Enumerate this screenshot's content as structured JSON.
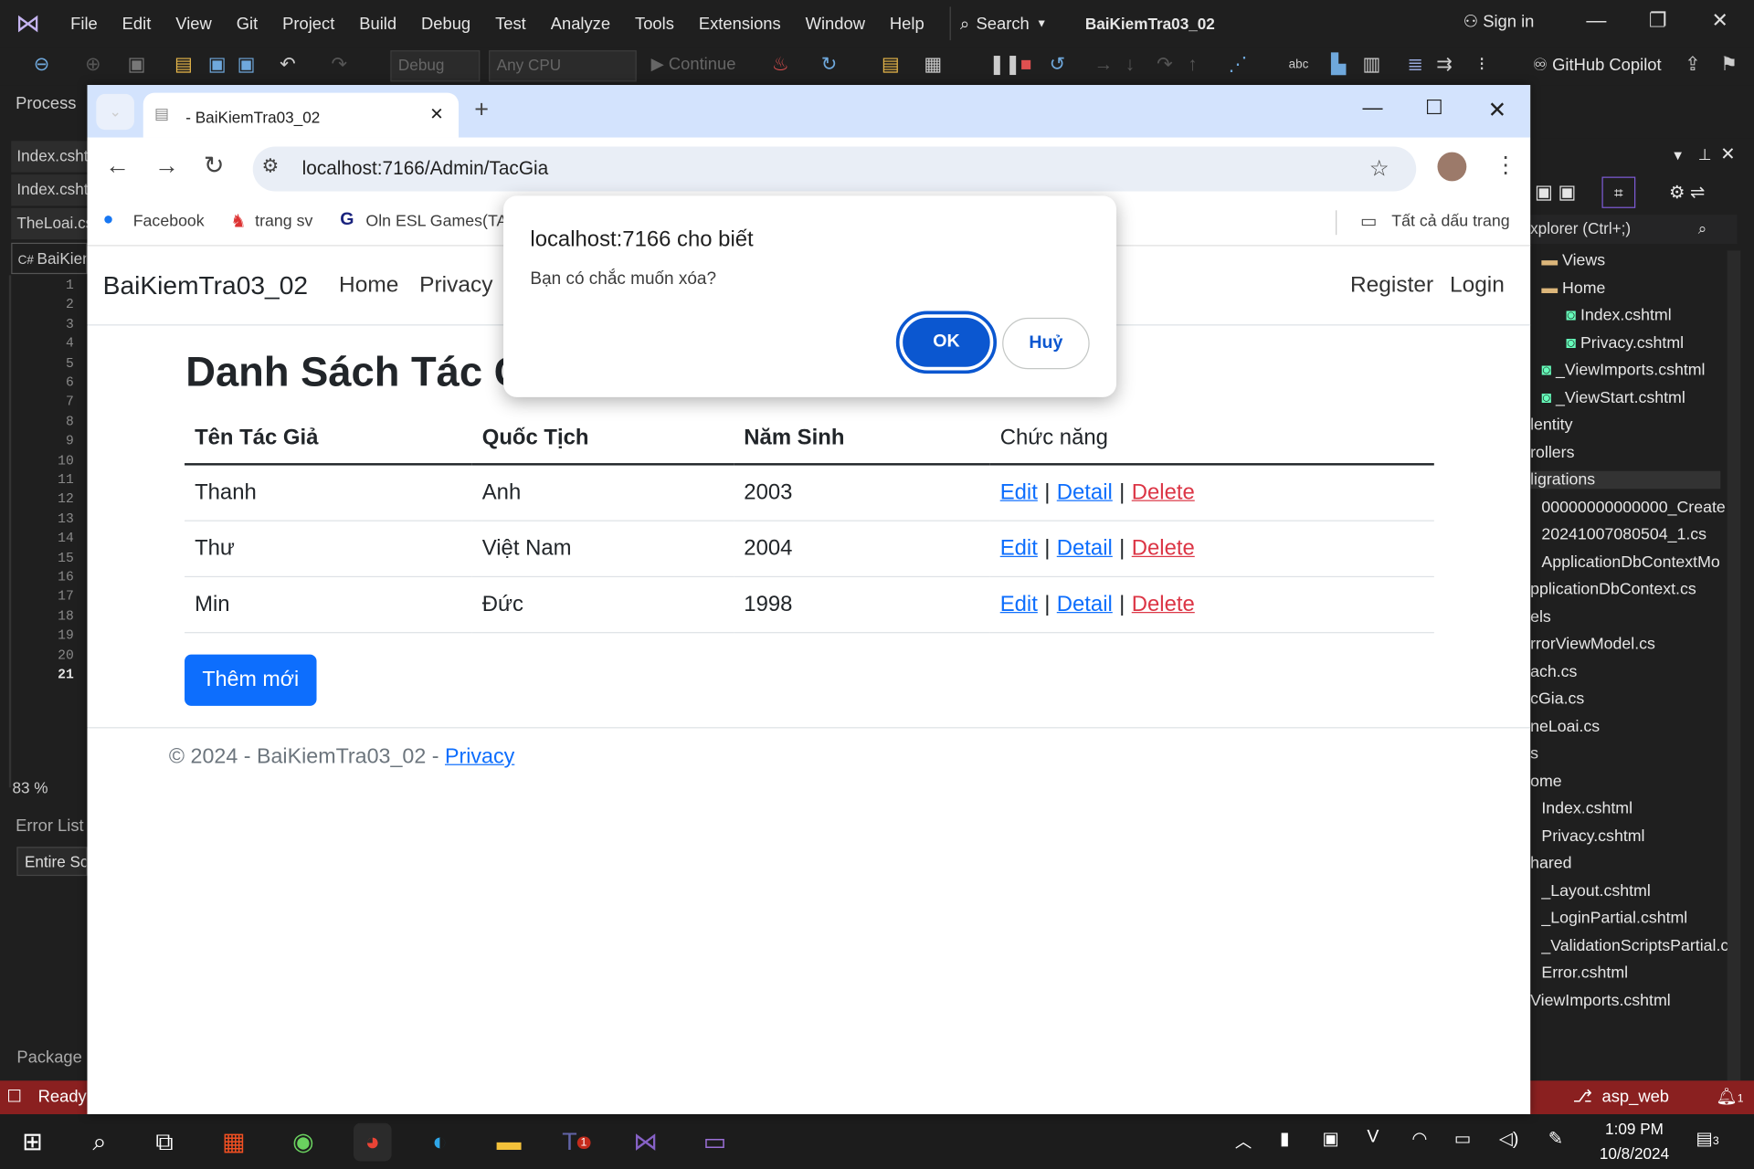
{
  "vs": {
    "menu": [
      "File",
      "Edit",
      "View",
      "Git",
      "Project",
      "Build",
      "Debug",
      "Test",
      "Analyze",
      "Tools",
      "Extensions",
      "Window",
      "Help"
    ],
    "search_label": "Search",
    "solution_title": "BaiKiemTra03_02",
    "sign_in": "Sign in",
    "config": "Debug",
    "platform": "Any CPU",
    "continue_label": "Continue",
    "copilot_label": "GitHub Copilot",
    "process_label": "Process",
    "left_tabs": [
      "Index.csht",
      "Index.csht",
      "TheLoai.cs",
      "BaiKien"
    ],
    "line_numbers": [
      "1",
      "2",
      "3",
      "4",
      "5",
      "6",
      "7",
      "8",
      "9",
      "10",
      "11",
      "12",
      "13",
      "14",
      "15",
      "16",
      "17",
      "18",
      "19",
      "20",
      "21"
    ],
    "zoom": "83 %",
    "error_list": "Error List",
    "entire_scope": "Entire Sc",
    "package_manager": "Package M",
    "status_ready": "Ready",
    "status_branch": "asp_web",
    "notif_count": "1",
    "solution_explorer_search": "xplorer (Ctrl+;)",
    "tree": [
      "Views",
      "Home",
      "Index.cshtml",
      "Privacy.cshtml",
      "_ViewImports.cshtml",
      "_ViewStart.cshtml",
      "lentity",
      "rollers",
      "ligrations",
      "00000000000000_Create",
      "20241007080504_1.cs",
      "ApplicationDbContextMo",
      "pplicationDbContext.cs",
      "els",
      "rrorViewModel.cs",
      "ach.cs",
      "cGia.cs",
      "neLoai.cs",
      "s",
      "ome",
      "Index.cshtml",
      "Privacy.cshtml",
      "hared",
      "_Layout.cshtml",
      "_LoginPartial.cshtml",
      "_ValidationScriptsPartial.c",
      "Error.cshtml",
      "ViewImports.cshtml"
    ]
  },
  "browser": {
    "tab_title": "- BaiKiemTra03_02",
    "url": "localhost:7166/Admin/TacGia",
    "bookmarks": [
      "Facebook",
      "trang sv",
      "Oln ESL Games(TA)"
    ],
    "all_bookmarks": "Tất cả dấu trang"
  },
  "page": {
    "brand": "BaiKiemTra03_02",
    "nav": [
      "Home",
      "Privacy"
    ],
    "nav_right": [
      "Register",
      "Login"
    ],
    "heading": "Danh Sách Tác Giả",
    "columns": [
      "Tên Tác Giả",
      "Quốc Tịch",
      "Năm Sinh",
      "Chức năng"
    ],
    "rows": [
      {
        "name": "Thanh",
        "country": "Anh",
        "year": "2003"
      },
      {
        "name": "Thư",
        "country": "Việt Nam",
        "year": "2004"
      },
      {
        "name": "Min",
        "country": "Đức",
        "year": "1998"
      }
    ],
    "action_edit": "Edit",
    "action_detail": "Detail",
    "action_delete": "Delete",
    "separator": "|",
    "add_button": "Thêm mới",
    "footer_prefix": "© 2024 - BaiKiemTra03_02 - ",
    "footer_link": "Privacy"
  },
  "dialog": {
    "title": "localhost:7166 cho biết",
    "message": "Bạn có chắc muốn xóa?",
    "ok": "OK",
    "cancel": "Huỷ"
  },
  "taskbar": {
    "time": "1:09 PM",
    "date": "10/8/2024",
    "teams_badge": "1",
    "notif_badge": "3"
  }
}
